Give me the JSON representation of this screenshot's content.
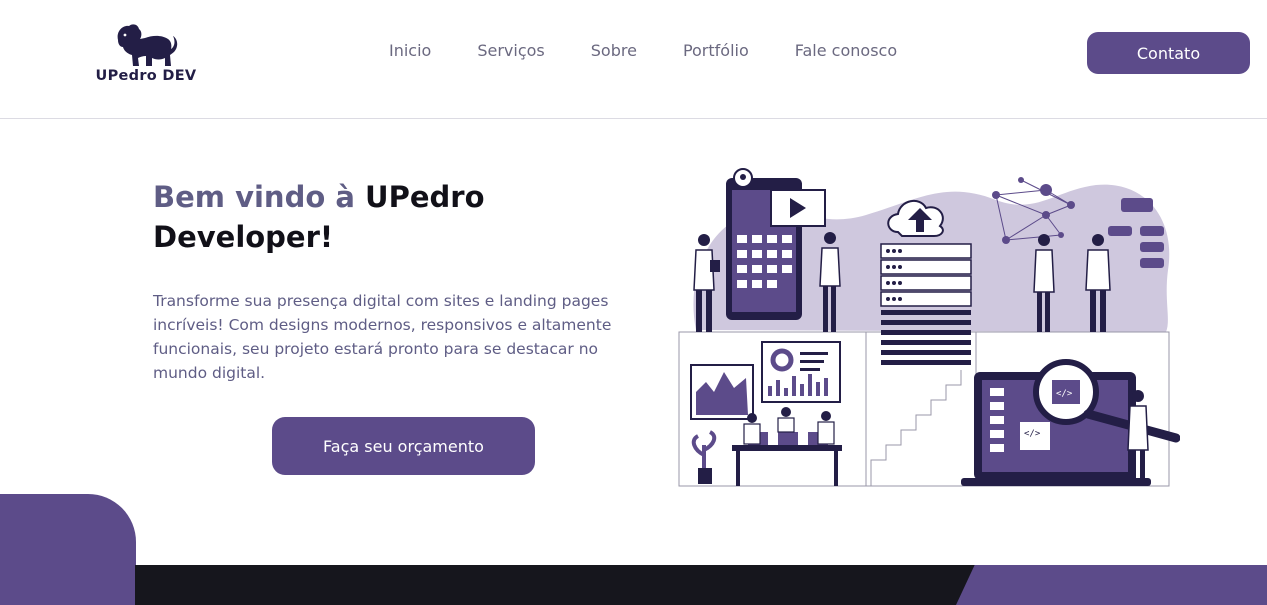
{
  "brand": {
    "name": "UPedro DEV",
    "logo_icon": "lion-icon"
  },
  "nav": {
    "items": [
      {
        "label": "Inicio"
      },
      {
        "label": "Serviços"
      },
      {
        "label": "Sobre"
      },
      {
        "label": "Portfólio"
      },
      {
        "label": "Fale conosco"
      }
    ]
  },
  "header": {
    "contact_label": "Contato"
  },
  "hero": {
    "title_accent": "Bem vindo à",
    "title_main": "UPedro Developer!",
    "description": "Transforme sua presença digital com sites e landing pages incríveis! Com designs modernos, responsivos e altamente funcionais, seu projeto estará pronto para se destacar no mundo digital.",
    "cta_label": "Faça seu orçamento",
    "illustration_icon": "tech-team-illustration-icon"
  },
  "colors": {
    "accent": "#5c4b8a",
    "title_accent": "#5f5d85",
    "dark": "#16161d",
    "lavender": "#cfc8de"
  }
}
